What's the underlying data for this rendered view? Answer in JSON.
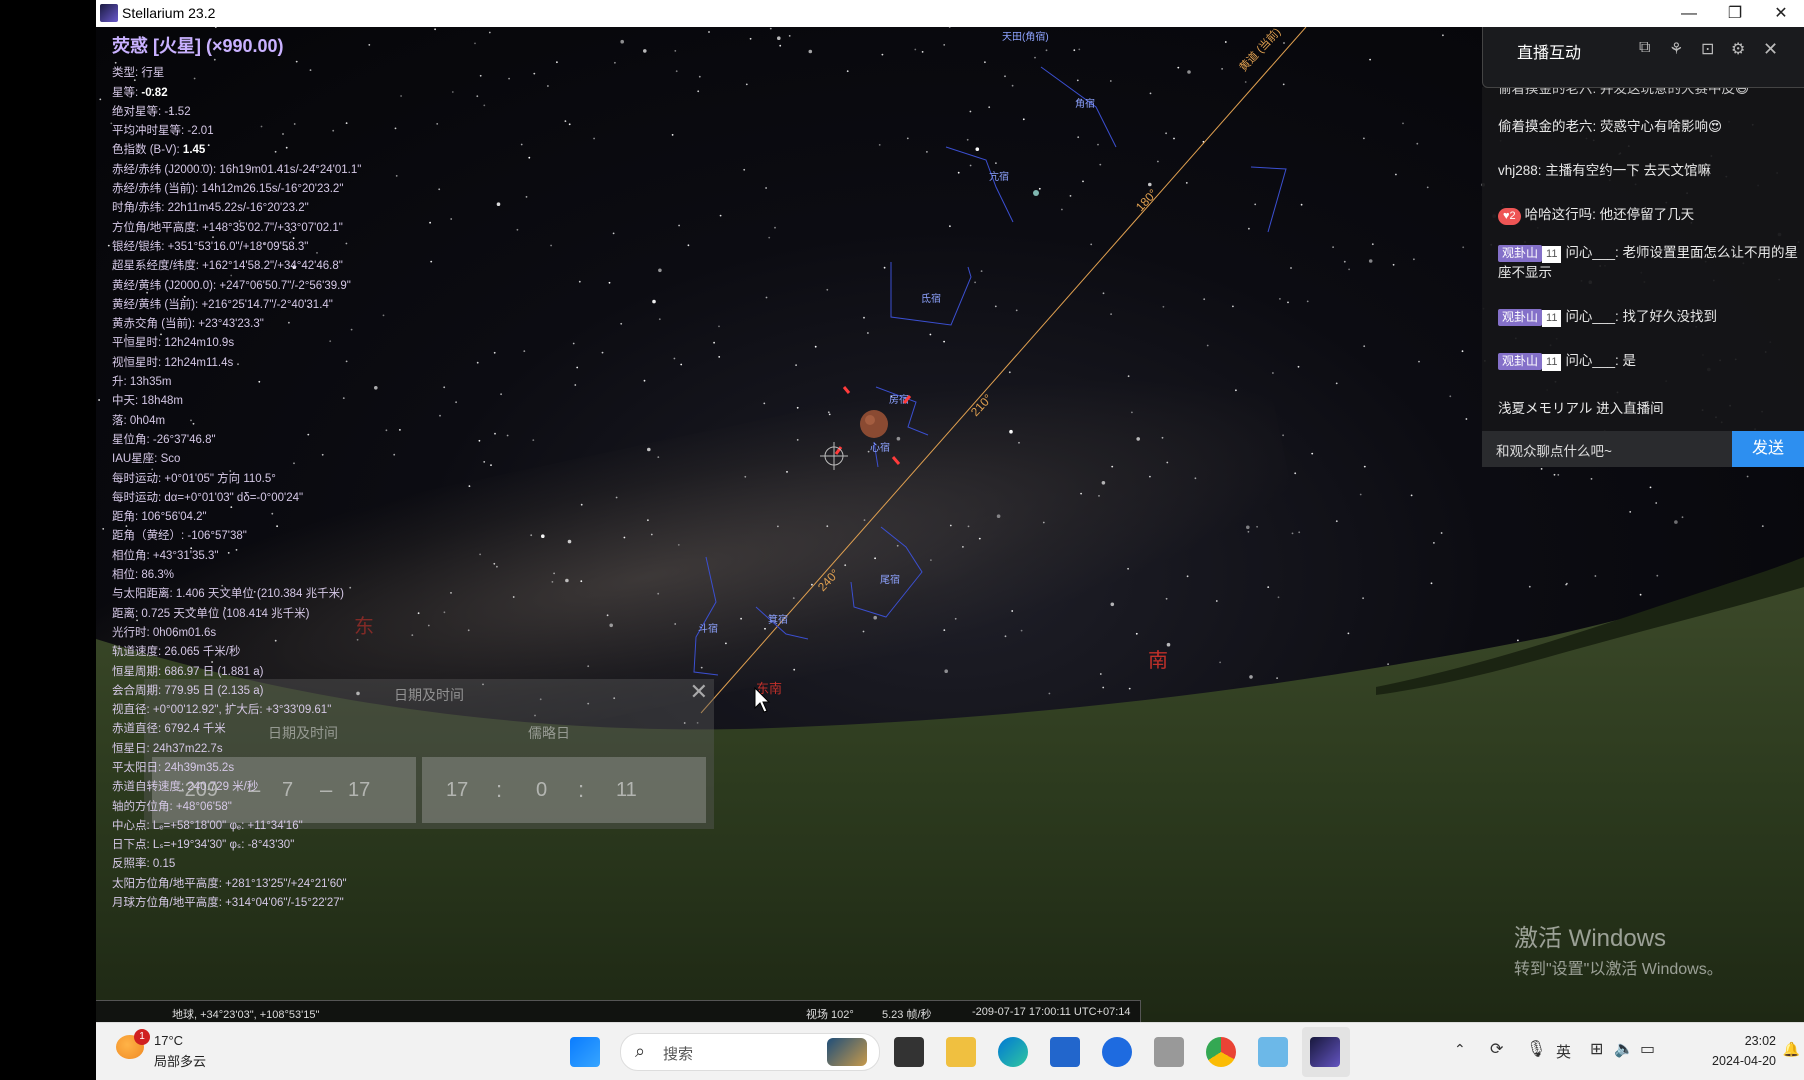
{
  "window": {
    "title": "Stellarium 23.2",
    "min": "—",
    "max": "❐",
    "close": "✕"
  },
  "object": {
    "title": "荧惑 [火星] (×990.00)",
    "rows": [
      {
        "k": "类型: ",
        "v": "行星"
      },
      {
        "k": "星等: ",
        "v": "-0.82",
        "bold": true
      },
      {
        "k": "绝对星等: ",
        "v": "-1.52"
      },
      {
        "k": "平均冲时星等: ",
        "v": "-2.01"
      },
      {
        "k": "色指数 (B-V): ",
        "v": "1.45",
        "bold": true
      },
      {
        "k": "赤经/赤纬 (J2000.0): ",
        "v": "16h19m01.41s/-24°24'01.1\""
      },
      {
        "k": "赤经/赤纬 (当前): ",
        "v": "14h12m26.15s/-16°20'23.2\""
      },
      {
        "k": "时角/赤纬: ",
        "v": "22h11m45.22s/-16°20'23.2\""
      },
      {
        "k": "方位角/地平高度: ",
        "v": "+148°35'02.7\"/+33°07'02.1\""
      },
      {
        "k": "银经/银纬: ",
        "v": "+351°53'16.0\"/+18°09'58.3\""
      },
      {
        "k": "超星系经度/纬度: ",
        "v": "+162°14'58.2\"/+34°42'46.8\""
      },
      {
        "k": "黄经/黄纬 (J2000.0): ",
        "v": "+247°06'50.7\"/-2°56'39.9\""
      },
      {
        "k": "黄经/黄纬 (当前): ",
        "v": "+216°25'14.7\"/-2°40'31.4\""
      },
      {
        "k": "黄赤交角 (当前): ",
        "v": "+23°43'23.3\""
      },
      {
        "k": "平恒星时: ",
        "v": "12h24m10.9s"
      },
      {
        "k": "视恒星时: ",
        "v": "12h24m11.4s"
      },
      {
        "k": "升: ",
        "v": "13h35m"
      },
      {
        "k": "中天: ",
        "v": "18h48m"
      },
      {
        "k": "落: ",
        "v": "0h04m"
      },
      {
        "k": "星位角: ",
        "v": "-26°37'46.8\""
      },
      {
        "k": "IAU星座: ",
        "v": "Sco"
      },
      {
        "k": "每时运动: ",
        "v": "+0°01'05\" 方向 110.5°"
      },
      {
        "k": "每时运动: ",
        "v": "dα=+0°01'03\" dδ=-0°00'24\""
      },
      {
        "k": "距角: ",
        "v": "106°56'04.2\""
      },
      {
        "k": "距角（黄经）: ",
        "v": "-106°57'38\""
      },
      {
        "k": "相位角: ",
        "v": "+43°31'35.3\""
      },
      {
        "k": "相位: ",
        "v": "86.3%"
      },
      {
        "k": "与太阳距离: ",
        "v": "1.406 天文单位 (210.384 兆千米)"
      },
      {
        "k": "距离: ",
        "v": "0.725 天文单位 (108.414 兆千米)"
      },
      {
        "k": "光行时: ",
        "v": "0h06m01.6s"
      },
      {
        "k": "轨道速度: ",
        "v": "26.065 千米/秒"
      },
      {
        "k": "恒星周期: ",
        "v": "686.97 日 (1.881 a)"
      },
      {
        "k": "会合周期: ",
        "v": "779.95 日 (2.135 a)"
      },
      {
        "k": "视直径: ",
        "v": "+0°00'12.92\", 扩大后: +3°33'09.61\""
      },
      {
        "k": "赤道直径: ",
        "v": "6792.4 千米"
      },
      {
        "k": "恒星日: ",
        "v": "24h37m22.7s"
      },
      {
        "k": "平太阳日: ",
        "v": "24h39m35.2s"
      },
      {
        "k": "赤道自转速度: ",
        "v": "240.729 米/秒"
      },
      {
        "k": "轴的方位角: ",
        "v": "+48°06'58\""
      },
      {
        "k": "中心点: ",
        "v": "Lₑ=+58°18'00\" φₑ: +11°34'16\""
      },
      {
        "k": "日下点: ",
        "v": "Lₛ=+19°34'30\" φₛ: -8°43'30\""
      },
      {
        "k": "反照率: ",
        "v": "0.15"
      },
      {
        "k": "太阳方位角/地平高度: ",
        "v": "+281°13'25\"/+24°21'60\""
      },
      {
        "k": "月球方位角/地平高度: ",
        "v": "+314°04'06\"/-15°22'27\""
      }
    ]
  },
  "sky_labels": {
    "tianmen": "天田(角宿)",
    "jiao": "角宿",
    "kang": "亢宿",
    "di": "氐宿",
    "fang": "房宿",
    "xin": "心宿",
    "wei": "尾宿",
    "ji": "箕宿",
    "dou": "斗宿",
    "ecliptic": "黄道 (当前)",
    "deg180": "180°",
    "deg210": "210°",
    "deg240": "240°",
    "south": "南",
    "east": "东",
    "southeast": "东南"
  },
  "datetime_dialog": {
    "title": "日期及时间",
    "tab1": "日期及时间",
    "tab2": "儒略日",
    "year": "-209",
    "month": "7",
    "day": "17",
    "hour": "17",
    "minute": "0",
    "second": "11",
    "dash": "–",
    "colon": ":"
  },
  "chat": {
    "title": "直播互动",
    "messages": [
      {
        "text": "偷着摸金的老六: 并发这玩意的大赛中皮😆"
      },
      {
        "text": "偷着摸金的老六: 荧惑守心有啥影响😍"
      },
      {
        "text": "vhj288: 主播有空约一下  去天文馆嘛"
      },
      {
        "heart": "♥2",
        "text": "哈哈这行吗: 他还停留了几天"
      },
      {
        "badge": "观卦山",
        "lvl": "11",
        "text": "问心___: 老师设置里面怎么让不用的星座不显示"
      },
      {
        "badge": "观卦山",
        "lvl": "11",
        "text": "问心___: 找了好久没找到"
      },
      {
        "badge": "观卦山",
        "lvl": "11",
        "text": "问心___: 是"
      },
      {
        "text": "浅夏メモリアル 进入直播间"
      }
    ],
    "placeholder": "和观众聊点什么吧~",
    "send": "发送"
  },
  "activation": {
    "line1": "激活 Windows",
    "line2": "转到\"设置\"以激活 Windows。"
  },
  "status": {
    "location": "地球, +34°23'03\", +108°53'15\"",
    "fov": "视场 102°",
    "fps": "5.23 帧/秒",
    "datetime": "-209-07-17 17:00:11 UTC+07:14"
  },
  "taskbar": {
    "temp": "17°C",
    "weather": "局部多云",
    "weather_badge": "1",
    "search": "搜索",
    "ime": "英",
    "time": "23:02",
    "date": "2024-04-20"
  },
  "colors": {
    "accent": "#2d8ff0",
    "title_purple": "#c9b1ff",
    "ecliptic": "#e0a050",
    "label_red": "#c0302a"
  }
}
